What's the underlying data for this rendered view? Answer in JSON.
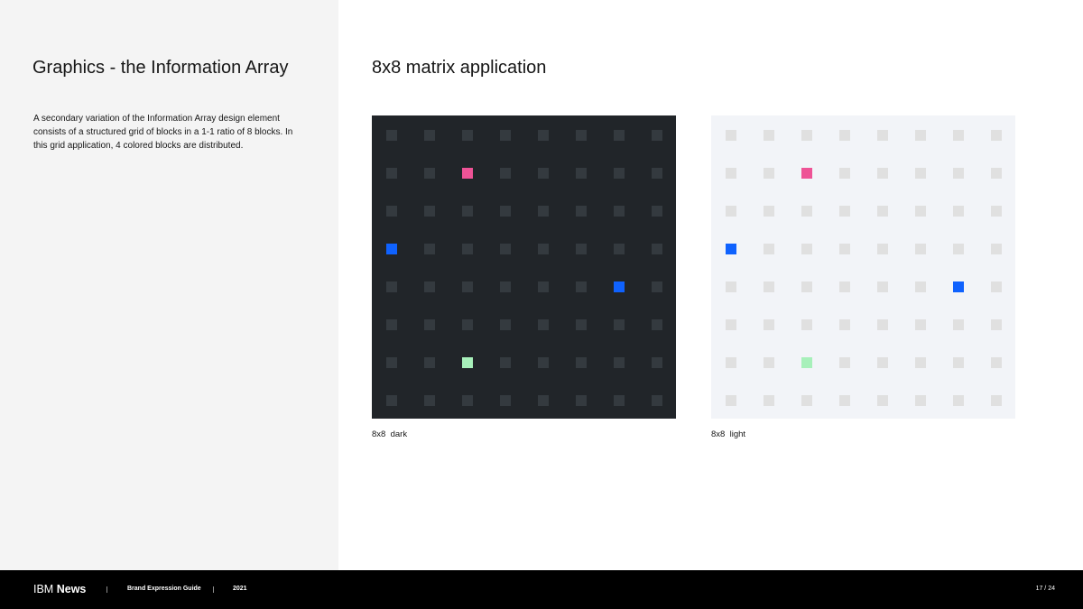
{
  "sidebar": {
    "title": "Graphics - the Information Array",
    "description": "A secondary variation of the Information Array design element consists of a structured grid of blocks in a 1-1 ratio of 8 blocks. In this grid application, 4 colored blocks are distributed."
  },
  "main": {
    "title": "8x8 matrix application",
    "matrices": [
      {
        "caption": "8x8  dark",
        "background": "#212529",
        "block_color": "#343a3f",
        "grid_size": 8,
        "colored_blocks": [
          {
            "row": 1,
            "col": 2,
            "color": "#ee5396"
          },
          {
            "row": 3,
            "col": 0,
            "color": "#0f62fe"
          },
          {
            "row": 4,
            "col": 6,
            "color": "#0f62fe"
          },
          {
            "row": 6,
            "col": 2,
            "color": "#a7f0ba"
          }
        ]
      },
      {
        "caption": "8x8  light",
        "background": "#f2f4f8",
        "block_color": "#e0e0e0",
        "grid_size": 8,
        "colored_blocks": [
          {
            "row": 1,
            "col": 2,
            "color": "#ee5396"
          },
          {
            "row": 3,
            "col": 0,
            "color": "#0f62fe"
          },
          {
            "row": 4,
            "col": 6,
            "color": "#0f62fe"
          },
          {
            "row": 6,
            "col": 2,
            "color": "#a7f0ba"
          }
        ]
      }
    ]
  },
  "footer": {
    "logo_prefix": "IBM",
    "logo_strong": "News",
    "guide": "Brand Expression Guide",
    "year": "2021",
    "page": "17 / 24"
  }
}
